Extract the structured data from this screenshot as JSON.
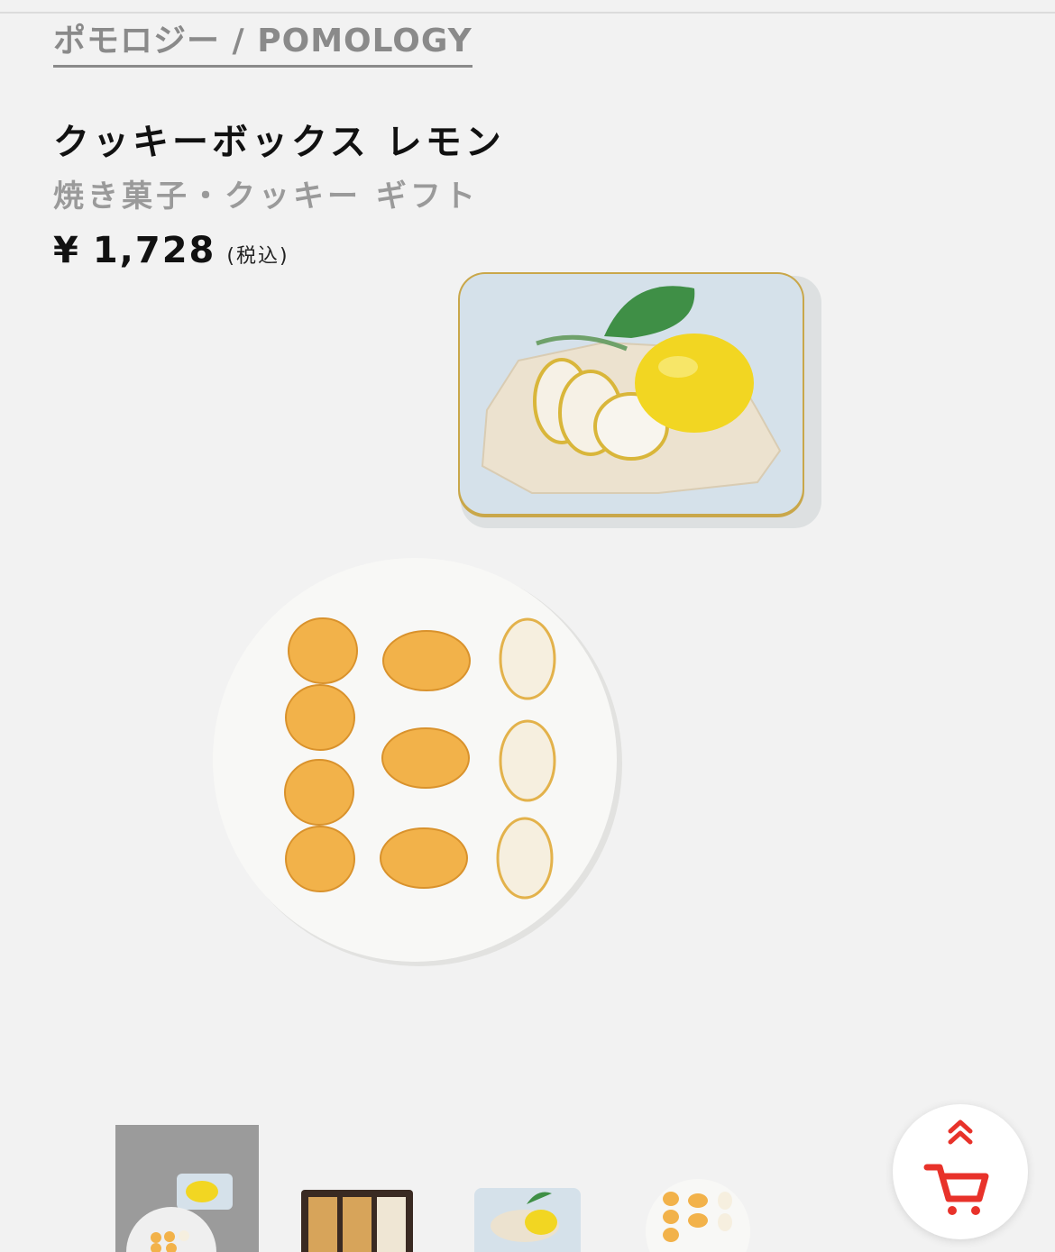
{
  "breadcrumb": {
    "brand_link": "ポモロジー / POMOLOGY"
  },
  "product": {
    "title": "クッキーボックス レモン",
    "category": "焼き菓子・クッキー ギフト",
    "price": {
      "currency_symbol": "¥",
      "amount": "1,728",
      "tax_note": "(税込)"
    }
  },
  "gallery": {
    "main_image": "cookie-box-lemon-tin-and-plate",
    "thumbnails": [
      {
        "name": "thumbnail-tin-and-plate",
        "selected": true
      },
      {
        "name": "thumbnail-box-open",
        "selected": false
      },
      {
        "name": "thumbnail-tin-lid",
        "selected": false
      },
      {
        "name": "thumbnail-cookie-plate",
        "selected": false
      }
    ]
  },
  "cart_button": {
    "icon": "cart-icon",
    "secondary_icon": "double-chevron-up-icon"
  },
  "colors": {
    "background": "#f2f2f2",
    "muted_text": "#8a8a8a",
    "accent_red": "#e8322a",
    "tin_blue": "#d5e1ea",
    "lemon_yellow": "#f2d622",
    "cookie_orange": "#f2b24a"
  }
}
